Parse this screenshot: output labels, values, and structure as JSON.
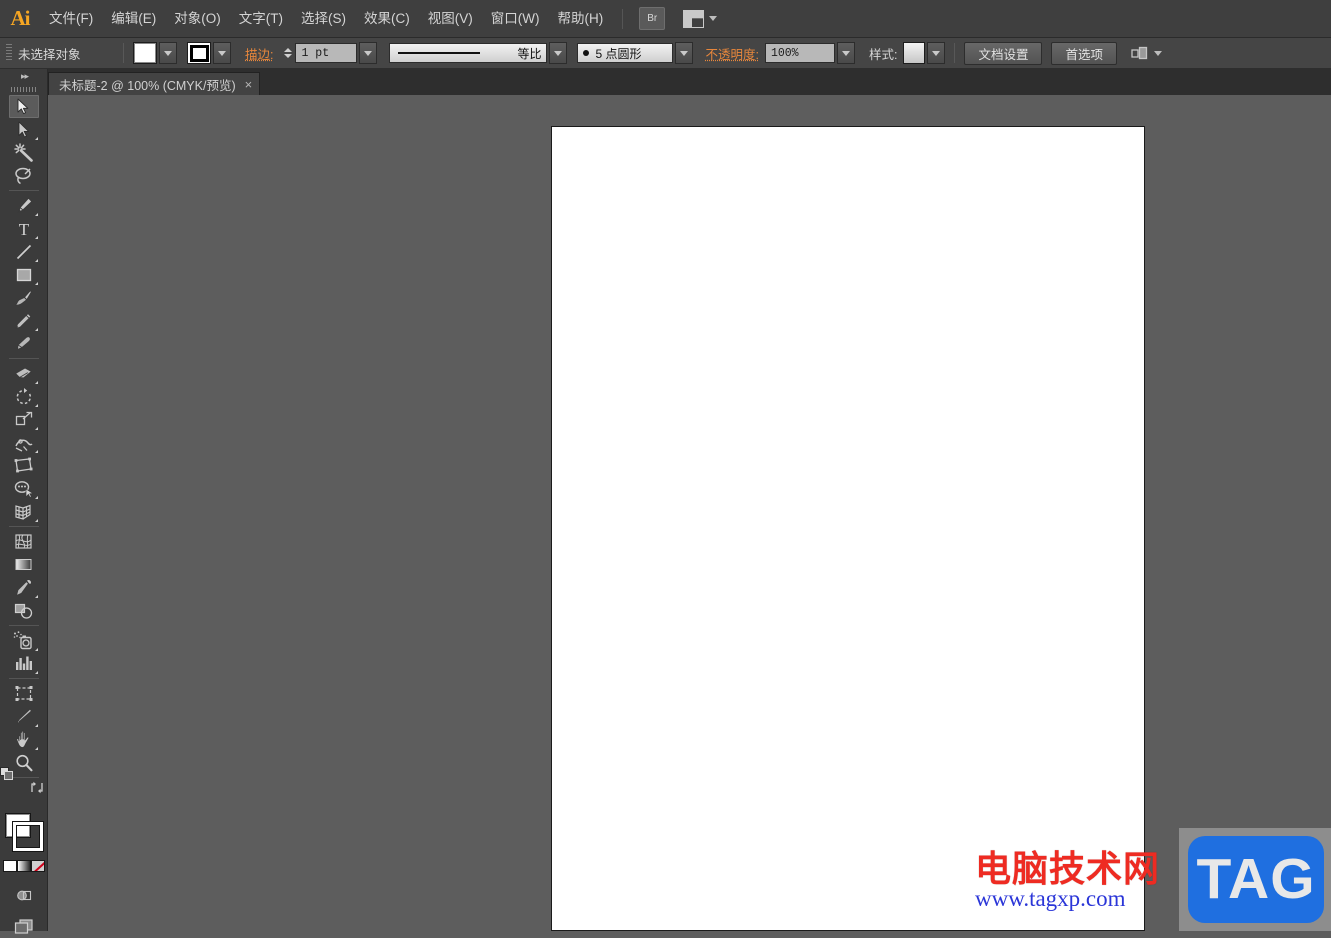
{
  "app": {
    "name": "Adobe Illustrator",
    "logo_text": "Ai"
  },
  "menubar": {
    "items": [
      {
        "label": "文件(F)",
        "accel": "F",
        "name": "menu-file"
      },
      {
        "label": "编辑(E)",
        "accel": "E",
        "name": "menu-edit"
      },
      {
        "label": "对象(O)",
        "accel": "O",
        "name": "menu-object"
      },
      {
        "label": "文字(T)",
        "accel": "T",
        "name": "menu-type"
      },
      {
        "label": "选择(S)",
        "accel": "S",
        "name": "menu-select"
      },
      {
        "label": "效果(C)",
        "accel": "C",
        "name": "menu-effect"
      },
      {
        "label": "视图(V)",
        "accel": "V",
        "name": "menu-view"
      },
      {
        "label": "窗口(W)",
        "accel": "W",
        "name": "menu-window"
      },
      {
        "label": "帮助(H)",
        "accel": "H",
        "name": "menu-help"
      }
    ],
    "bridge_label": "Br",
    "arrange_label": "排列文档"
  },
  "controlbar": {
    "selection_status": "未选择对象",
    "fill_color": "#ffffff",
    "stroke_color": "#ffffff",
    "stroke_label": "描边:",
    "stroke_weight": "1 pt",
    "stroke_profile": "等比",
    "brush_definition": "5 点圆形",
    "opacity_label": "不透明度:",
    "opacity_value": "100%",
    "style_label": "样式:",
    "document_setup_button": "文档设置",
    "preferences_button": "首选项"
  },
  "tabbar": {
    "document_tab": "未标题-2 @ 100% (CMYK/预览)",
    "close_glyph": "×"
  },
  "toolpanel": {
    "collapse_glyph": "▸▸",
    "tools": [
      {
        "name": "selection-tool",
        "label": "选择工具",
        "active": true,
        "has_flyout": false
      },
      {
        "name": "direct-selection-tool",
        "label": "直接选择工具",
        "active": false,
        "has_flyout": true
      },
      {
        "name": "magic-wand-tool",
        "label": "魔棒工具",
        "active": false,
        "has_flyout": false
      },
      {
        "name": "lasso-tool",
        "label": "套索工具",
        "active": false,
        "has_flyout": false
      },
      {
        "name": "pen-tool",
        "label": "钢笔工具",
        "active": false,
        "has_flyout": true
      },
      {
        "name": "type-tool",
        "label": "文字工具",
        "active": false,
        "has_flyout": true
      },
      {
        "name": "line-segment-tool",
        "label": "直线段工具",
        "active": false,
        "has_flyout": true
      },
      {
        "name": "rectangle-tool",
        "label": "矩形工具",
        "active": false,
        "has_flyout": true
      },
      {
        "name": "paintbrush-tool",
        "label": "画笔工具",
        "active": false,
        "has_flyout": false
      },
      {
        "name": "pencil-tool",
        "label": "铅笔工具",
        "active": false,
        "has_flyout": true
      },
      {
        "name": "blob-brush-tool",
        "label": "斑点画笔工具",
        "active": false,
        "has_flyout": false
      },
      {
        "name": "eraser-tool",
        "label": "橡皮擦工具",
        "active": false,
        "has_flyout": true
      },
      {
        "name": "rotate-tool",
        "label": "旋转工具",
        "active": false,
        "has_flyout": true
      },
      {
        "name": "scale-tool",
        "label": "比例缩放工具",
        "active": false,
        "has_flyout": true
      },
      {
        "name": "width-tool",
        "label": "宽度工具",
        "active": false,
        "has_flyout": true
      },
      {
        "name": "free-transform-tool",
        "label": "自由变换工具",
        "active": false,
        "has_flyout": false
      },
      {
        "name": "shape-builder-tool",
        "label": "形状生成器工具",
        "active": false,
        "has_flyout": true
      },
      {
        "name": "perspective-grid-tool",
        "label": "透视网格工具",
        "active": false,
        "has_flyout": true
      },
      {
        "name": "mesh-tool",
        "label": "网格工具",
        "active": false,
        "has_flyout": false
      },
      {
        "name": "gradient-tool",
        "label": "渐变工具",
        "active": false,
        "has_flyout": false
      },
      {
        "name": "eyedropper-tool",
        "label": "吸管工具",
        "active": false,
        "has_flyout": true
      },
      {
        "name": "blend-tool",
        "label": "混合工具",
        "active": false,
        "has_flyout": false
      },
      {
        "name": "symbol-sprayer-tool",
        "label": "符号喷枪工具",
        "active": false,
        "has_flyout": true
      },
      {
        "name": "column-graph-tool",
        "label": "柱形图工具",
        "active": false,
        "has_flyout": true
      },
      {
        "name": "artboard-tool",
        "label": "画板工具",
        "active": false,
        "has_flyout": false
      },
      {
        "name": "slice-tool",
        "label": "切片工具",
        "active": false,
        "has_flyout": true
      },
      {
        "name": "hand-tool",
        "label": "抓手工具",
        "active": false,
        "has_flyout": true
      },
      {
        "name": "zoom-tool",
        "label": "缩放工具",
        "active": false,
        "has_flyout": false
      }
    ],
    "fill_color": "#ffffff",
    "stroke_color": "#ffffff",
    "color_modes": [
      "color-mode-solid",
      "color-mode-gradient",
      "color-mode-none"
    ],
    "screen_mode_label": "更改屏幕模式"
  },
  "canvas": {
    "background_color": "#5d5d5d",
    "artboard_color": "#ffffff",
    "zoom_level": "100%"
  },
  "watermark": {
    "site_name": "电脑技术网",
    "site_url": "www.tagxp.com",
    "badge_text": "TAG",
    "badge_color": "#1f6fe0",
    "title_color": "#ee2b22",
    "url_color": "#2b36d8"
  }
}
